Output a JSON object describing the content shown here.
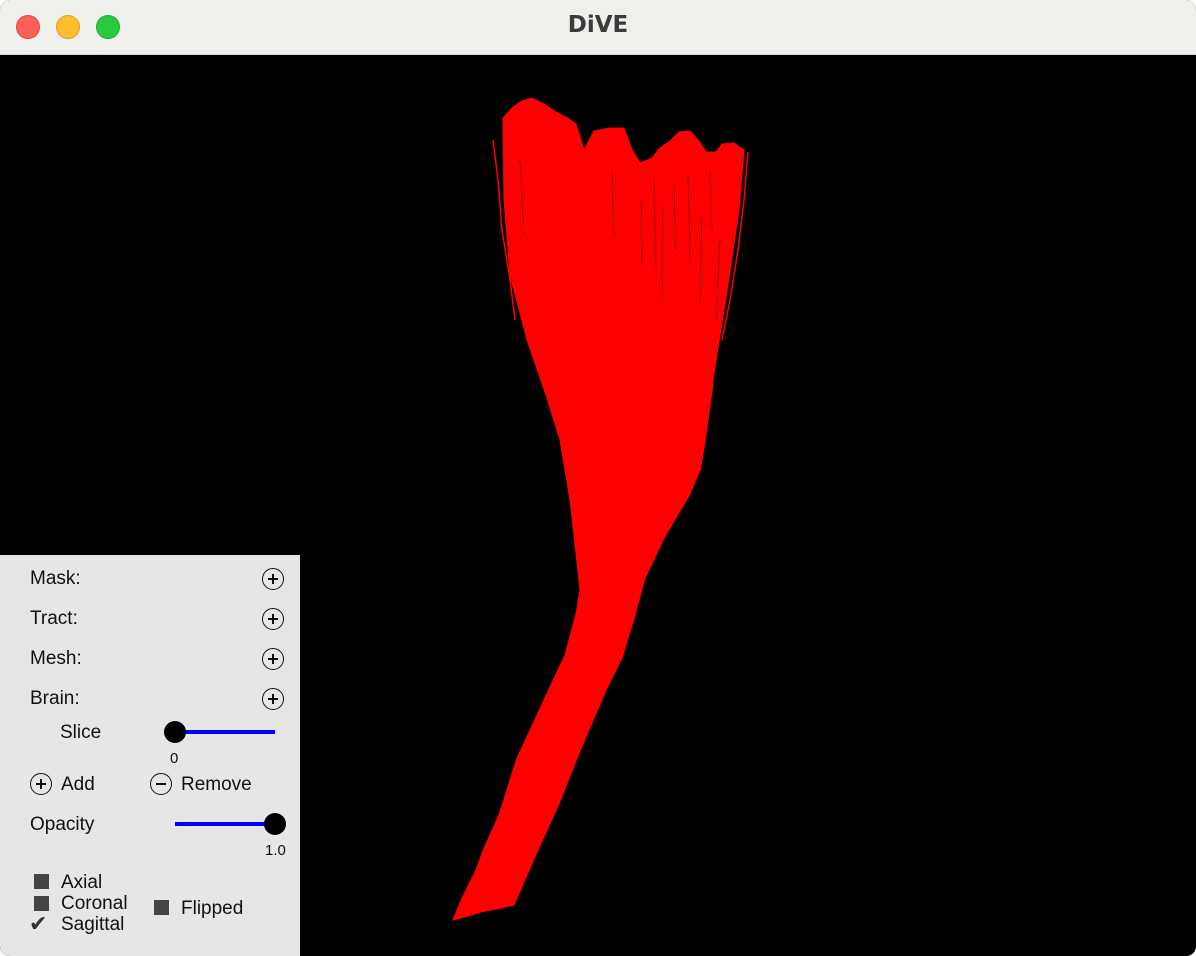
{
  "window": {
    "title": "DiVE"
  },
  "viewport": {
    "background": "#000000",
    "tract_color": "#ff0000"
  },
  "panel": {
    "mask_label": "Mask:",
    "tract_label": "Tract:",
    "mesh_label": "Mesh:",
    "brain_label": "Brain:",
    "slice_label": "Slice",
    "slice_value": "0",
    "add_label": "Add",
    "remove_label": "Remove",
    "opacity_label": "Opacity",
    "opacity_value": "1.0",
    "axial_label": "Axial",
    "coronal_label": "Coronal",
    "sagittal_label": "Sagittal",
    "flipped_label": "Flipped",
    "slider_color": "#0000ff",
    "slice_level": 0,
    "opacity_level": 1.0
  }
}
